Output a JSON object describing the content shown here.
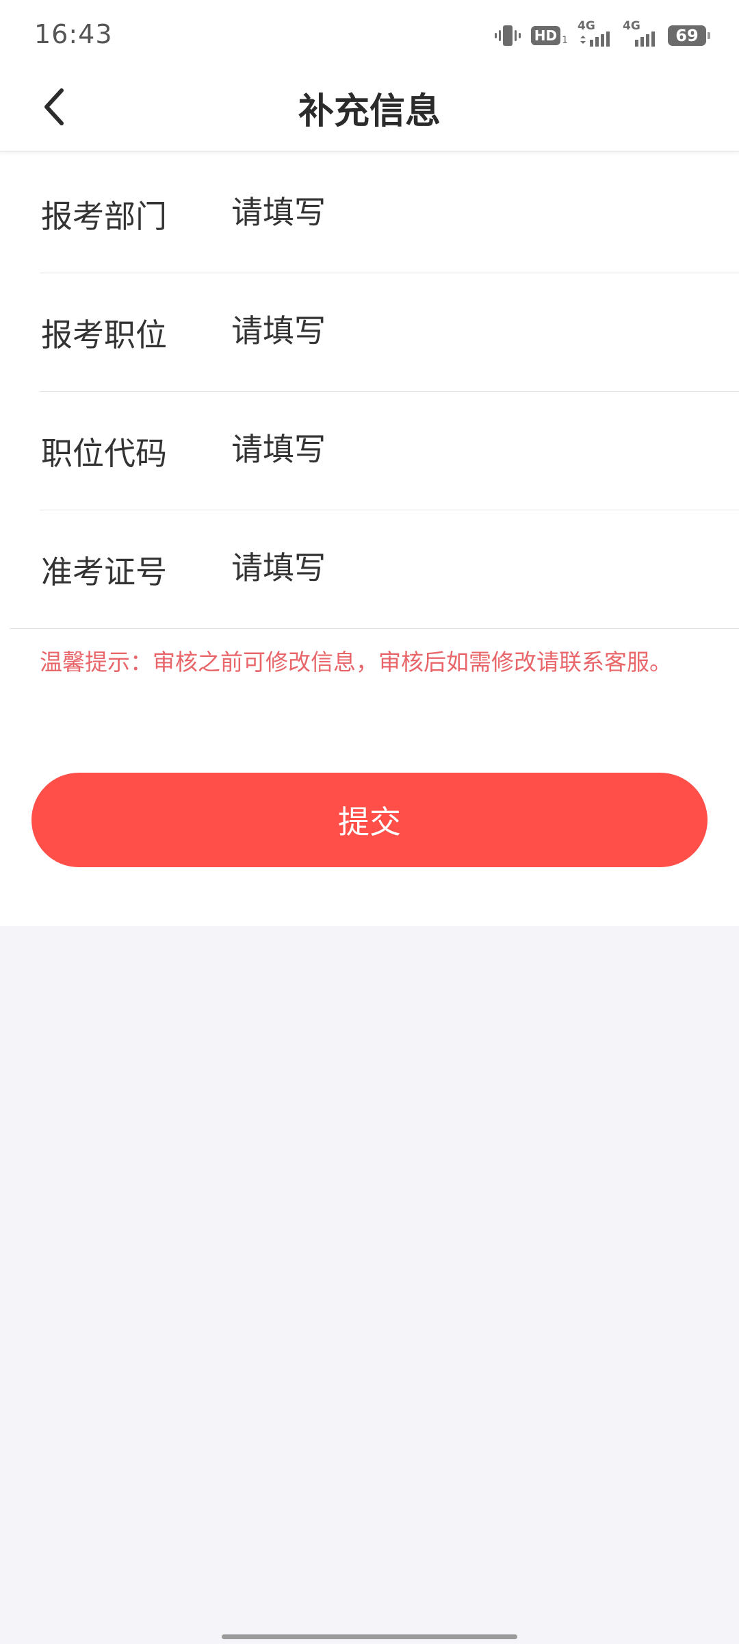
{
  "status_bar": {
    "time": "16:43",
    "hd_label": "HD",
    "hd_sub": "1",
    "network_1": "4G",
    "network_2": "4G",
    "battery": "69"
  },
  "header": {
    "title": "补充信息",
    "back_icon": "chevron-left-icon"
  },
  "form": {
    "rows": [
      {
        "label": "报考部门",
        "placeholder": "请填写",
        "value": ""
      },
      {
        "label": "报考职位",
        "placeholder": "请填写",
        "value": ""
      },
      {
        "label": "职位代码",
        "placeholder": "请填写",
        "value": ""
      },
      {
        "label": "准考证号",
        "placeholder": "请填写",
        "value": ""
      }
    ],
    "tip": "温馨提示：审核之前可修改信息，审核后如需修改请联系客服。",
    "submit_label": "提交"
  },
  "colors": {
    "accent": "#ff4f48",
    "tip_text": "#e8666a",
    "page_background": "#f4f4f9"
  }
}
